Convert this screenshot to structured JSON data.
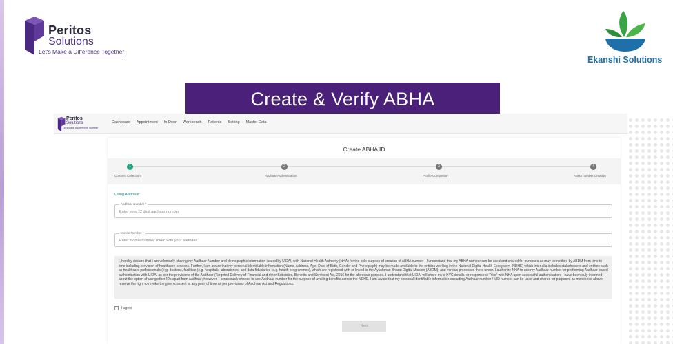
{
  "slide": {
    "title": "Create & Verify ABHA",
    "peritos_logo": {
      "name": "Peritos",
      "sub": "Solutions",
      "tagline": "Let's Make a Difference Together"
    },
    "ekanshi_logo": {
      "name": "Ekanshi Solutions"
    },
    "colors": {
      "banner": "#4a2079",
      "brand_purple": "#4b2f7c",
      "ekanshi_blue": "#1f6fa8",
      "ekanshi_green": "#3aa345",
      "step_active": "#20a184"
    }
  },
  "app": {
    "logo": {
      "name": "Peritos",
      "sub": "Solutions",
      "tagline": "Let's Make a Difference Together"
    },
    "nav": [
      "Dashboard",
      "Appointment",
      "In Door",
      "Workbench",
      "Patients",
      "Setting",
      "Master Data"
    ],
    "card_title": "Create ABHA ID",
    "steps": [
      {
        "number": "1",
        "label": "Consent Collection",
        "active": true
      },
      {
        "number": "2",
        "label": "Aadhaar Authentication",
        "active": false
      },
      {
        "number": "3",
        "label": "Profile Completion",
        "active": false
      },
      {
        "number": "4",
        "label": "ABHA number Creation",
        "active": false
      }
    ],
    "using_label": "Using Aadhaar",
    "aadhaar_field": {
      "label": "Aadhaar Number *",
      "placeholder": "Enter your 12 digit aadhaar number"
    },
    "mobile_field": {
      "label": "Mobile Number *",
      "placeholder": "Enter mobile number linked with your aadhaar"
    },
    "consent_text": "I, hereby declare that I am voluntarily sharing my Aadhaar Number and demographic information issued by UIDAI, with National Health Authority (NHA) for the sole purpose of creation of ABHA number . I understand that my ABHA number can be used and shared for purposes as may be notified by ABDM from time to time including provision of healthcare services. Further, I am aware that my personal identifiable information (Name, Address, Age, Date of Birth, Gender and Photograph) may be made available to the entities working in the National Digital Health Ecosystem (NDHE) which inter alia includes stakeholders and entities such as healthcare professionals (e.g. doctors), facilities (e.g. hospitals, laboratories) and data fiduciaries (e.g. health programmes), which are registered with or linked to the Ayushman Bharat Digital Mission (ABDM), and various processes there under. I authorize NHA to use my Aadhaar number for performing Aadhaar based authentication with UIDAI as per the provisions of the Aadhaar (Targeted Delivery of Financial and other Subsidies, Benefits and Services) Act, 2016 for the aforesaid purpose. I understand that UIDAI will share my e-KYC details, or response of \"Yes\" with NHA upon successful authentication. I have been duly informed about the option of using other IDs apart from Aadhaar; however, I consciously choose to use Aadhaar number for the purpose of availing benefits across the NDHE. I am aware that my personal identifiable information excluding Aadhaar number / VID number can be used and shared for purposes as mentioned above. I reserve the right to revoke the given consent at any point of time as per provisions of Aadhaar Act and Regulations.",
    "agree_label": "I agree",
    "submit_label": "Next"
  }
}
